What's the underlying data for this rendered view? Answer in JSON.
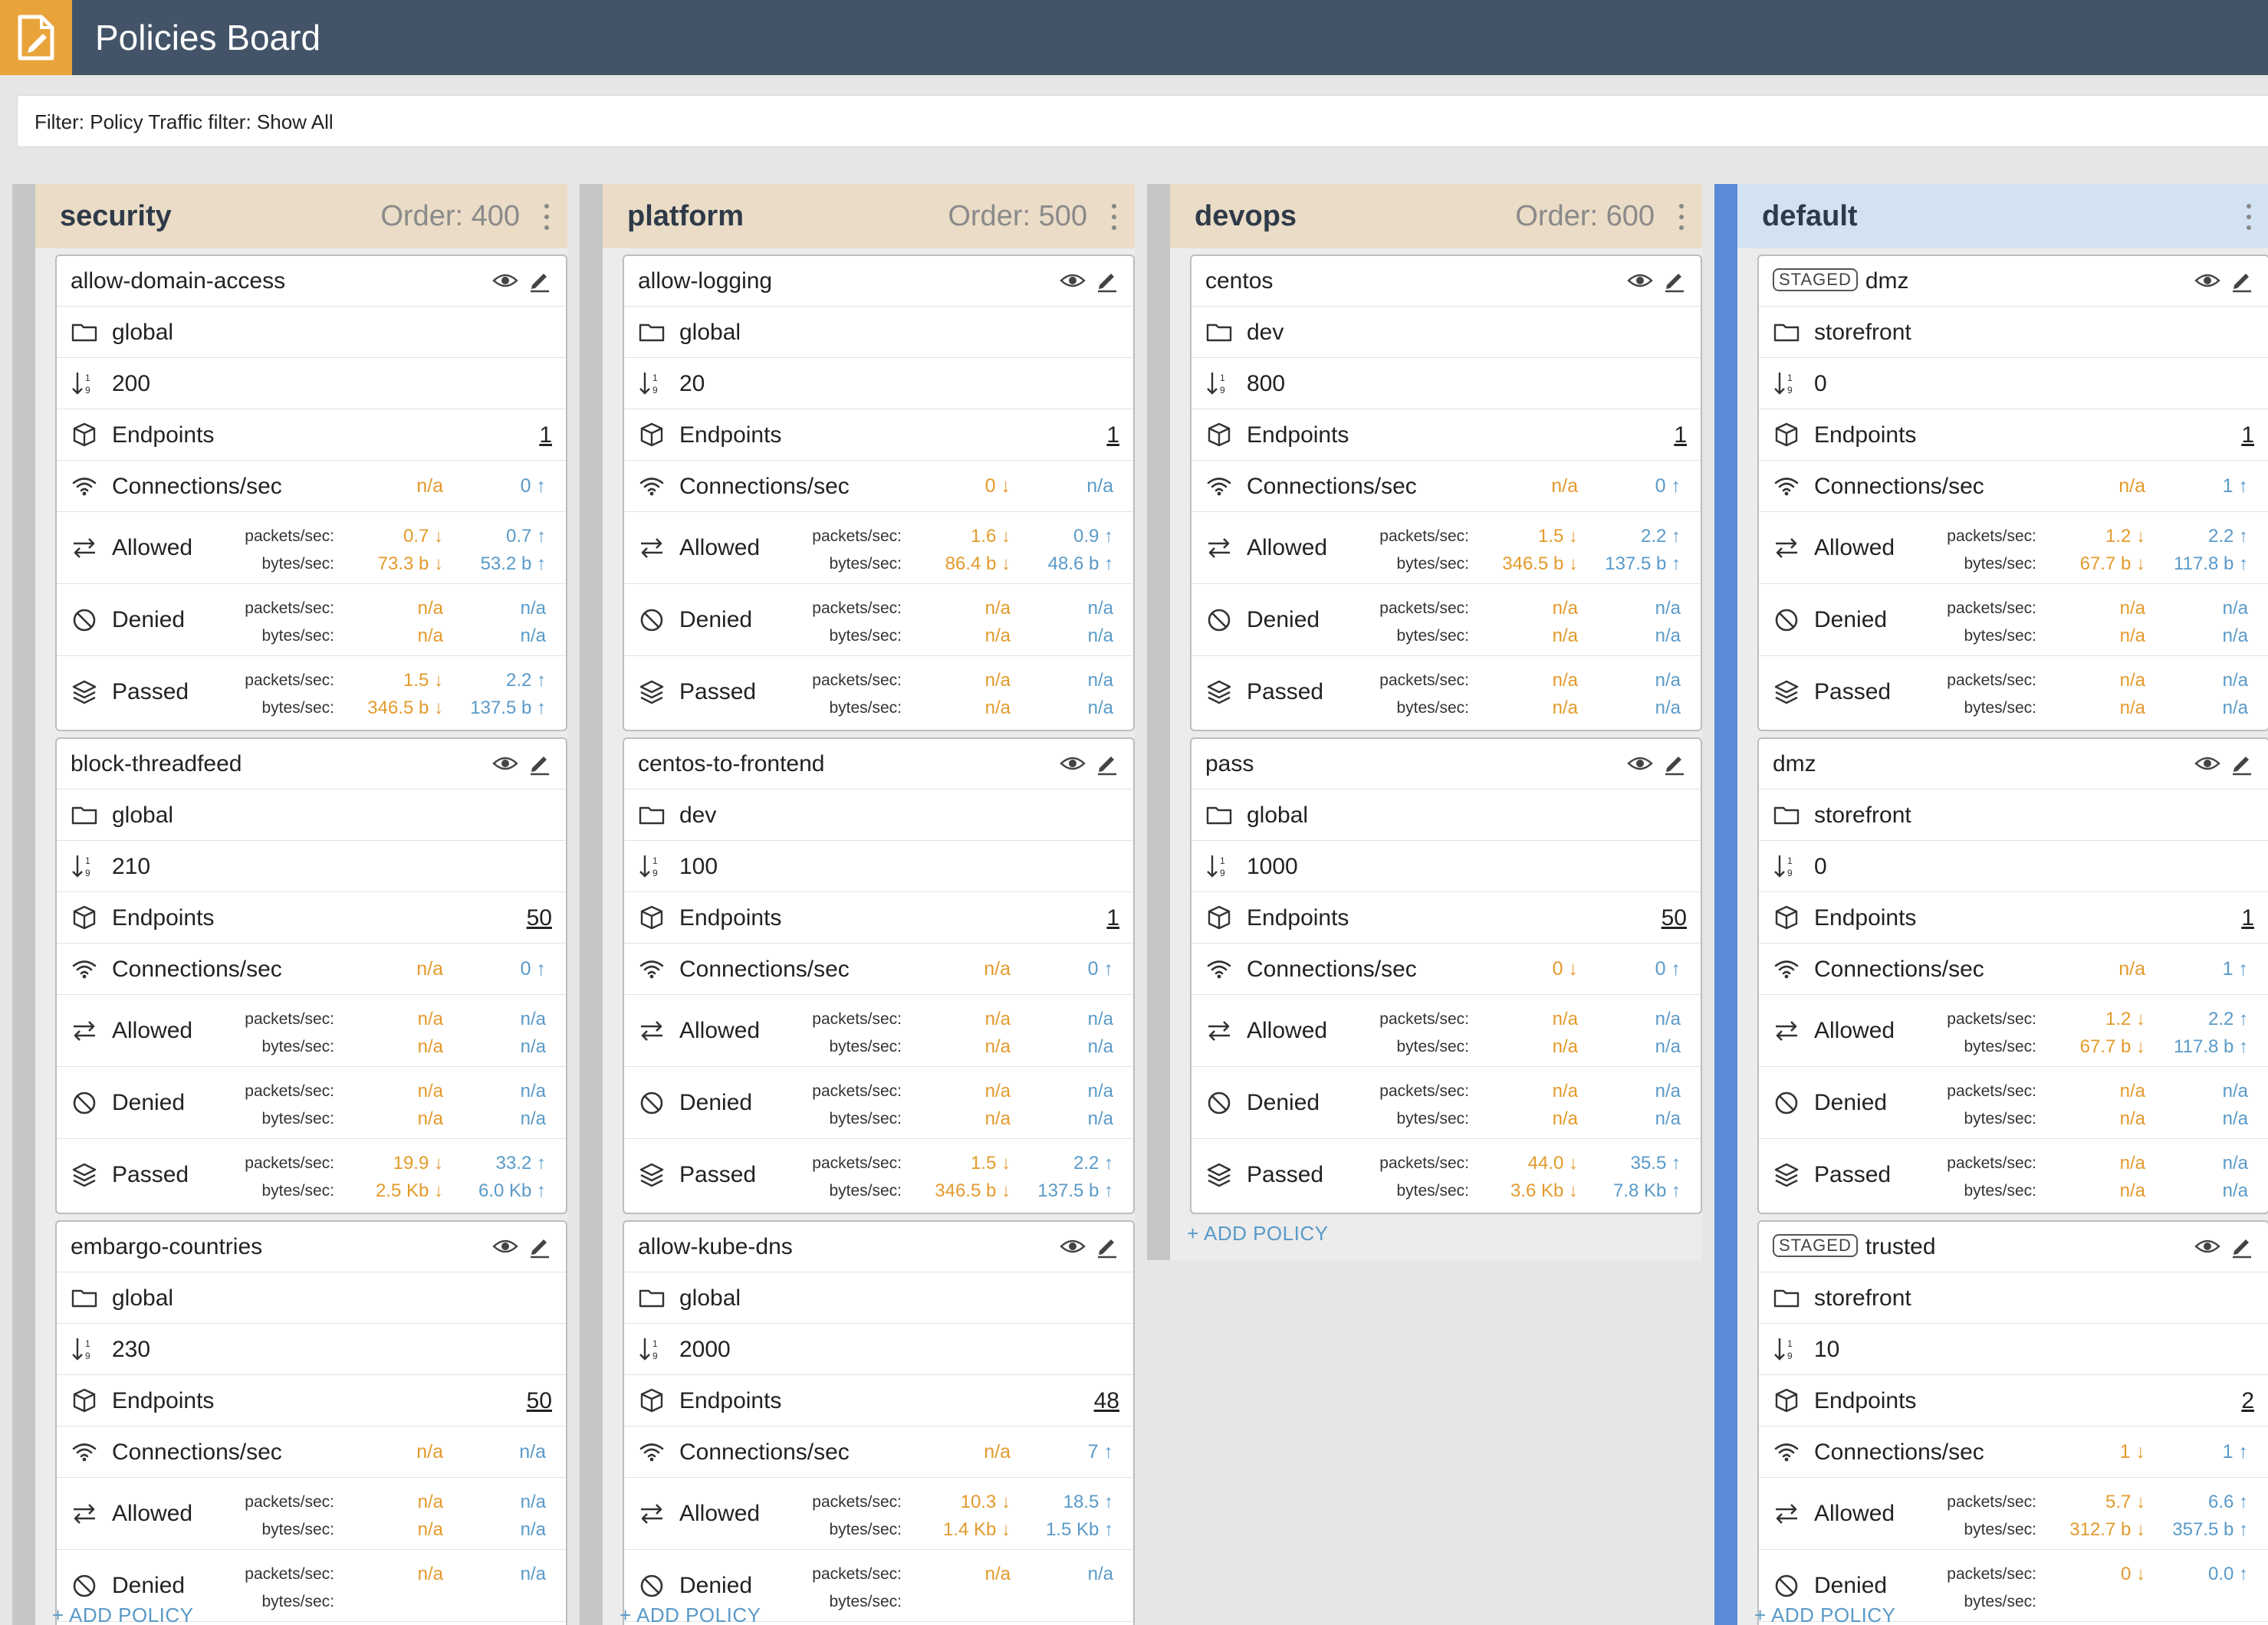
{
  "app": {
    "title": "Policies Board",
    "logo_icon": "policy-document-icon",
    "accent": "#e8a33a",
    "header_bg": "#435468"
  },
  "filter": {
    "text": "Filter: Policy Traffic filter: Show All"
  },
  "add_policy_label": "+ ADD POLICY",
  "staged_label": "STAGED",
  "metric_labels": {
    "endpoints": "Endpoints",
    "connections": "Connections/sec",
    "allowed": "Allowed",
    "denied": "Denied",
    "passed": "Passed",
    "packets": "packets/sec:",
    "bytes": "bytes/sec:"
  },
  "colors": {
    "incoming": "#e39a2c",
    "outgoing": "#5a9ac8",
    "tier_header": "#eadcc6",
    "default_header": "#d3e2f3",
    "default_accent": "#5b8bd9"
  },
  "tiers": [
    {
      "name": "security",
      "order": "Order: 400",
      "policies": [
        {
          "name": "allow-domain-access",
          "staged": false,
          "namespace": "global",
          "order": "200",
          "endpoints": "1",
          "conn_in": "n/a",
          "conn_out": "0 ↑",
          "allowed": {
            "pin": "0.7 ↓",
            "bin": "73.3 b ↓",
            "pout": "0.7 ↑",
            "bout": "53.2 b ↑"
          },
          "denied": {
            "pin": "n/a",
            "bin": "n/a",
            "pout": "n/a",
            "bout": "n/a"
          },
          "passed": {
            "pin": "1.5 ↓",
            "bin": "346.5 b ↓",
            "pout": "2.2 ↑",
            "bout": "137.5 b ↑"
          }
        },
        {
          "name": "block-threadfeed",
          "staged": false,
          "namespace": "global",
          "order": "210",
          "endpoints": "50",
          "conn_in": "n/a",
          "conn_out": "0 ↑",
          "allowed": {
            "pin": "n/a",
            "bin": "n/a",
            "pout": "n/a",
            "bout": "n/a"
          },
          "denied": {
            "pin": "n/a",
            "bin": "n/a",
            "pout": "n/a",
            "bout": "n/a"
          },
          "passed": {
            "pin": "19.9 ↓",
            "bin": "2.5 Kb ↓",
            "pout": "33.2 ↑",
            "bout": "6.0 Kb ↑"
          }
        },
        {
          "name": "embargo-countries",
          "staged": false,
          "namespace": "global",
          "order": "230",
          "endpoints": "50",
          "conn_in": "n/a",
          "conn_out": "n/a",
          "allowed": {
            "pin": "n/a",
            "bin": "n/a",
            "pout": "n/a",
            "bout": "n/a"
          },
          "denied": {
            "pin": "n/a",
            "bin": "",
            "pout": "n/a",
            "bout": ""
          },
          "passed": {
            "pin": "",
            "bin": "",
            "pout": "",
            "bout": ""
          }
        }
      ]
    },
    {
      "name": "platform",
      "order": "Order: 500",
      "policies": [
        {
          "name": "allow-logging",
          "staged": false,
          "namespace": "global",
          "order": "20",
          "endpoints": "1",
          "conn_in": "0 ↓",
          "conn_out": "n/a",
          "allowed": {
            "pin": "1.6 ↓",
            "bin": "86.4 b ↓",
            "pout": "0.9 ↑",
            "bout": "48.6 b ↑"
          },
          "denied": {
            "pin": "n/a",
            "bin": "n/a",
            "pout": "n/a",
            "bout": "n/a"
          },
          "passed": {
            "pin": "n/a",
            "bin": "n/a",
            "pout": "n/a",
            "bout": "n/a"
          }
        },
        {
          "name": "centos-to-frontend",
          "staged": false,
          "namespace": "dev",
          "order": "100",
          "endpoints": "1",
          "conn_in": "n/a",
          "conn_out": "0 ↑",
          "allowed": {
            "pin": "n/a",
            "bin": "n/a",
            "pout": "n/a",
            "bout": "n/a"
          },
          "denied": {
            "pin": "n/a",
            "bin": "n/a",
            "pout": "n/a",
            "bout": "n/a"
          },
          "passed": {
            "pin": "1.5 ↓",
            "bin": "346.5 b ↓",
            "pout": "2.2 ↑",
            "bout": "137.5 b ↑"
          }
        },
        {
          "name": "allow-kube-dns",
          "staged": false,
          "namespace": "global",
          "order": "2000",
          "endpoints": "48",
          "conn_in": "n/a",
          "conn_out": "7 ↑",
          "allowed": {
            "pin": "10.3 ↓",
            "bin": "1.4 Kb ↓",
            "pout": "18.5 ↑",
            "bout": "1.5 Kb ↑"
          },
          "denied": {
            "pin": "n/a",
            "bin": "",
            "pout": "n/a",
            "bout": ""
          },
          "passed": {
            "pin": "",
            "bin": "",
            "pout": "",
            "bout": ""
          }
        }
      ]
    },
    {
      "name": "devops",
      "order": "Order: 600",
      "policies": [
        {
          "name": "centos",
          "staged": false,
          "namespace": "dev",
          "order": "800",
          "endpoints": "1",
          "conn_in": "n/a",
          "conn_out": "0 ↑",
          "allowed": {
            "pin": "1.5 ↓",
            "bin": "346.5 b ↓",
            "pout": "2.2 ↑",
            "bout": "137.5 b ↑"
          },
          "denied": {
            "pin": "n/a",
            "bin": "n/a",
            "pout": "n/a",
            "bout": "n/a"
          },
          "passed": {
            "pin": "n/a",
            "bin": "n/a",
            "pout": "n/a",
            "bout": "n/a"
          }
        },
        {
          "name": "pass",
          "staged": false,
          "namespace": "global",
          "order": "1000",
          "endpoints": "50",
          "conn_in": "0 ↓",
          "conn_out": "0 ↑",
          "allowed": {
            "pin": "n/a",
            "bin": "n/a",
            "pout": "n/a",
            "bout": "n/a"
          },
          "denied": {
            "pin": "n/a",
            "bin": "n/a",
            "pout": "n/a",
            "bout": "n/a"
          },
          "passed": {
            "pin": "44.0 ↓",
            "bin": "3.6 Kb ↓",
            "pout": "35.5 ↑",
            "bout": "7.8 Kb ↑"
          }
        }
      ]
    },
    {
      "name": "default",
      "order": "",
      "policies": [
        {
          "name": "dmz",
          "staged": true,
          "namespace": "storefront",
          "order": "0",
          "endpoints": "1",
          "conn_in": "n/a",
          "conn_out": "1 ↑",
          "allowed": {
            "pin": "1.2 ↓",
            "bin": "67.7 b ↓",
            "pout": "2.2 ↑",
            "bout": "117.8 b ↑"
          },
          "denied": {
            "pin": "n/a",
            "bin": "n/a",
            "pout": "n/a",
            "bout": "n/a"
          },
          "passed": {
            "pin": "n/a",
            "bin": "n/a",
            "pout": "n/a",
            "bout": "n/a"
          }
        },
        {
          "name": "dmz",
          "staged": false,
          "namespace": "storefront",
          "order": "0",
          "endpoints": "1",
          "conn_in": "n/a",
          "conn_out": "1 ↑",
          "allowed": {
            "pin": "1.2 ↓",
            "bin": "67.7 b ↓",
            "pout": "2.2 ↑",
            "bout": "117.8 b ↑"
          },
          "denied": {
            "pin": "n/a",
            "bin": "n/a",
            "pout": "n/a",
            "bout": "n/a"
          },
          "passed": {
            "pin": "n/a",
            "bin": "n/a",
            "pout": "n/a",
            "bout": "n/a"
          }
        },
        {
          "name": "trusted",
          "staged": true,
          "namespace": "storefront",
          "order": "10",
          "endpoints": "2",
          "conn_in": "1 ↓",
          "conn_out": "1 ↑",
          "allowed": {
            "pin": "5.7 ↓",
            "bin": "312.7 b ↓",
            "pout": "6.6 ↑",
            "bout": "357.5 b ↑"
          },
          "denied": {
            "pin": "0 ↓",
            "bin": "",
            "pout": "0.0 ↑",
            "bout": ""
          },
          "passed": {
            "pin": "",
            "bin": "",
            "pout": "",
            "bout": ""
          }
        }
      ]
    }
  ]
}
